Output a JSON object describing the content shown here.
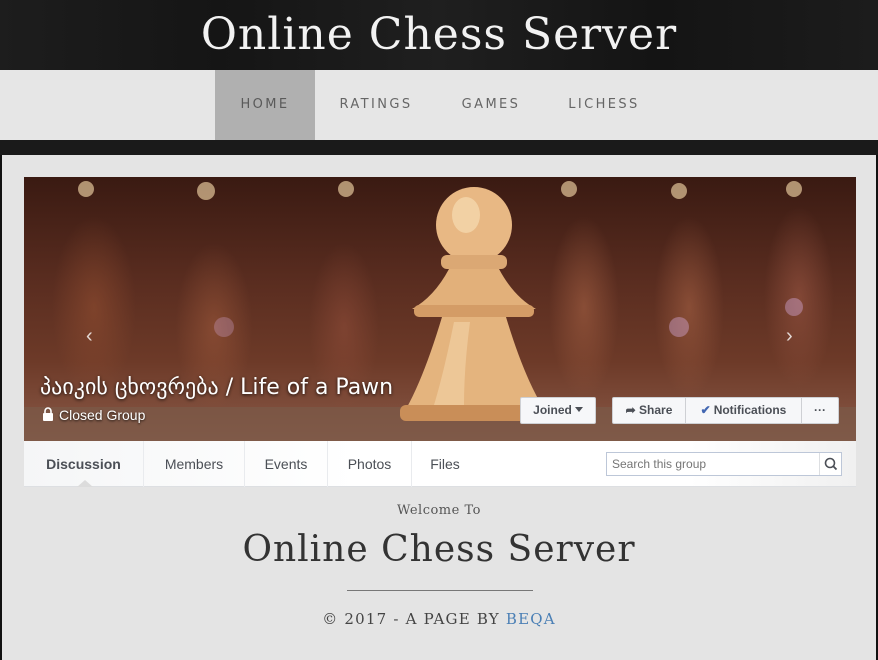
{
  "header": {
    "title": "Online Chess Server"
  },
  "nav": {
    "items": [
      {
        "label": "HOME",
        "active": true
      },
      {
        "label": "RATINGS"
      },
      {
        "label": "GAMES"
      },
      {
        "label": "LICHESS"
      }
    ]
  },
  "group": {
    "name": "პაიკის ცხოვრება / Life of a Pawn",
    "type": "Closed Group",
    "buttons": {
      "joined": "Joined",
      "share": "Share",
      "notifications": "Notifications",
      "more": "···"
    },
    "arrows": {
      "prev": "‹",
      "next": "›"
    },
    "tabs": [
      "Discussion",
      "Members",
      "Events",
      "Photos",
      "Files"
    ],
    "search_placeholder": "Search this group"
  },
  "welcome": {
    "pre": "Welcome To",
    "title": "Online Chess Server",
    "footer_prefix": "© 2017 - A PAGE BY ",
    "footer_link": "BEQA"
  },
  "colors": {
    "accent_link": "#4a7fb5",
    "nav_active": "#b0b0b0",
    "fb_check": "#4267b2"
  }
}
